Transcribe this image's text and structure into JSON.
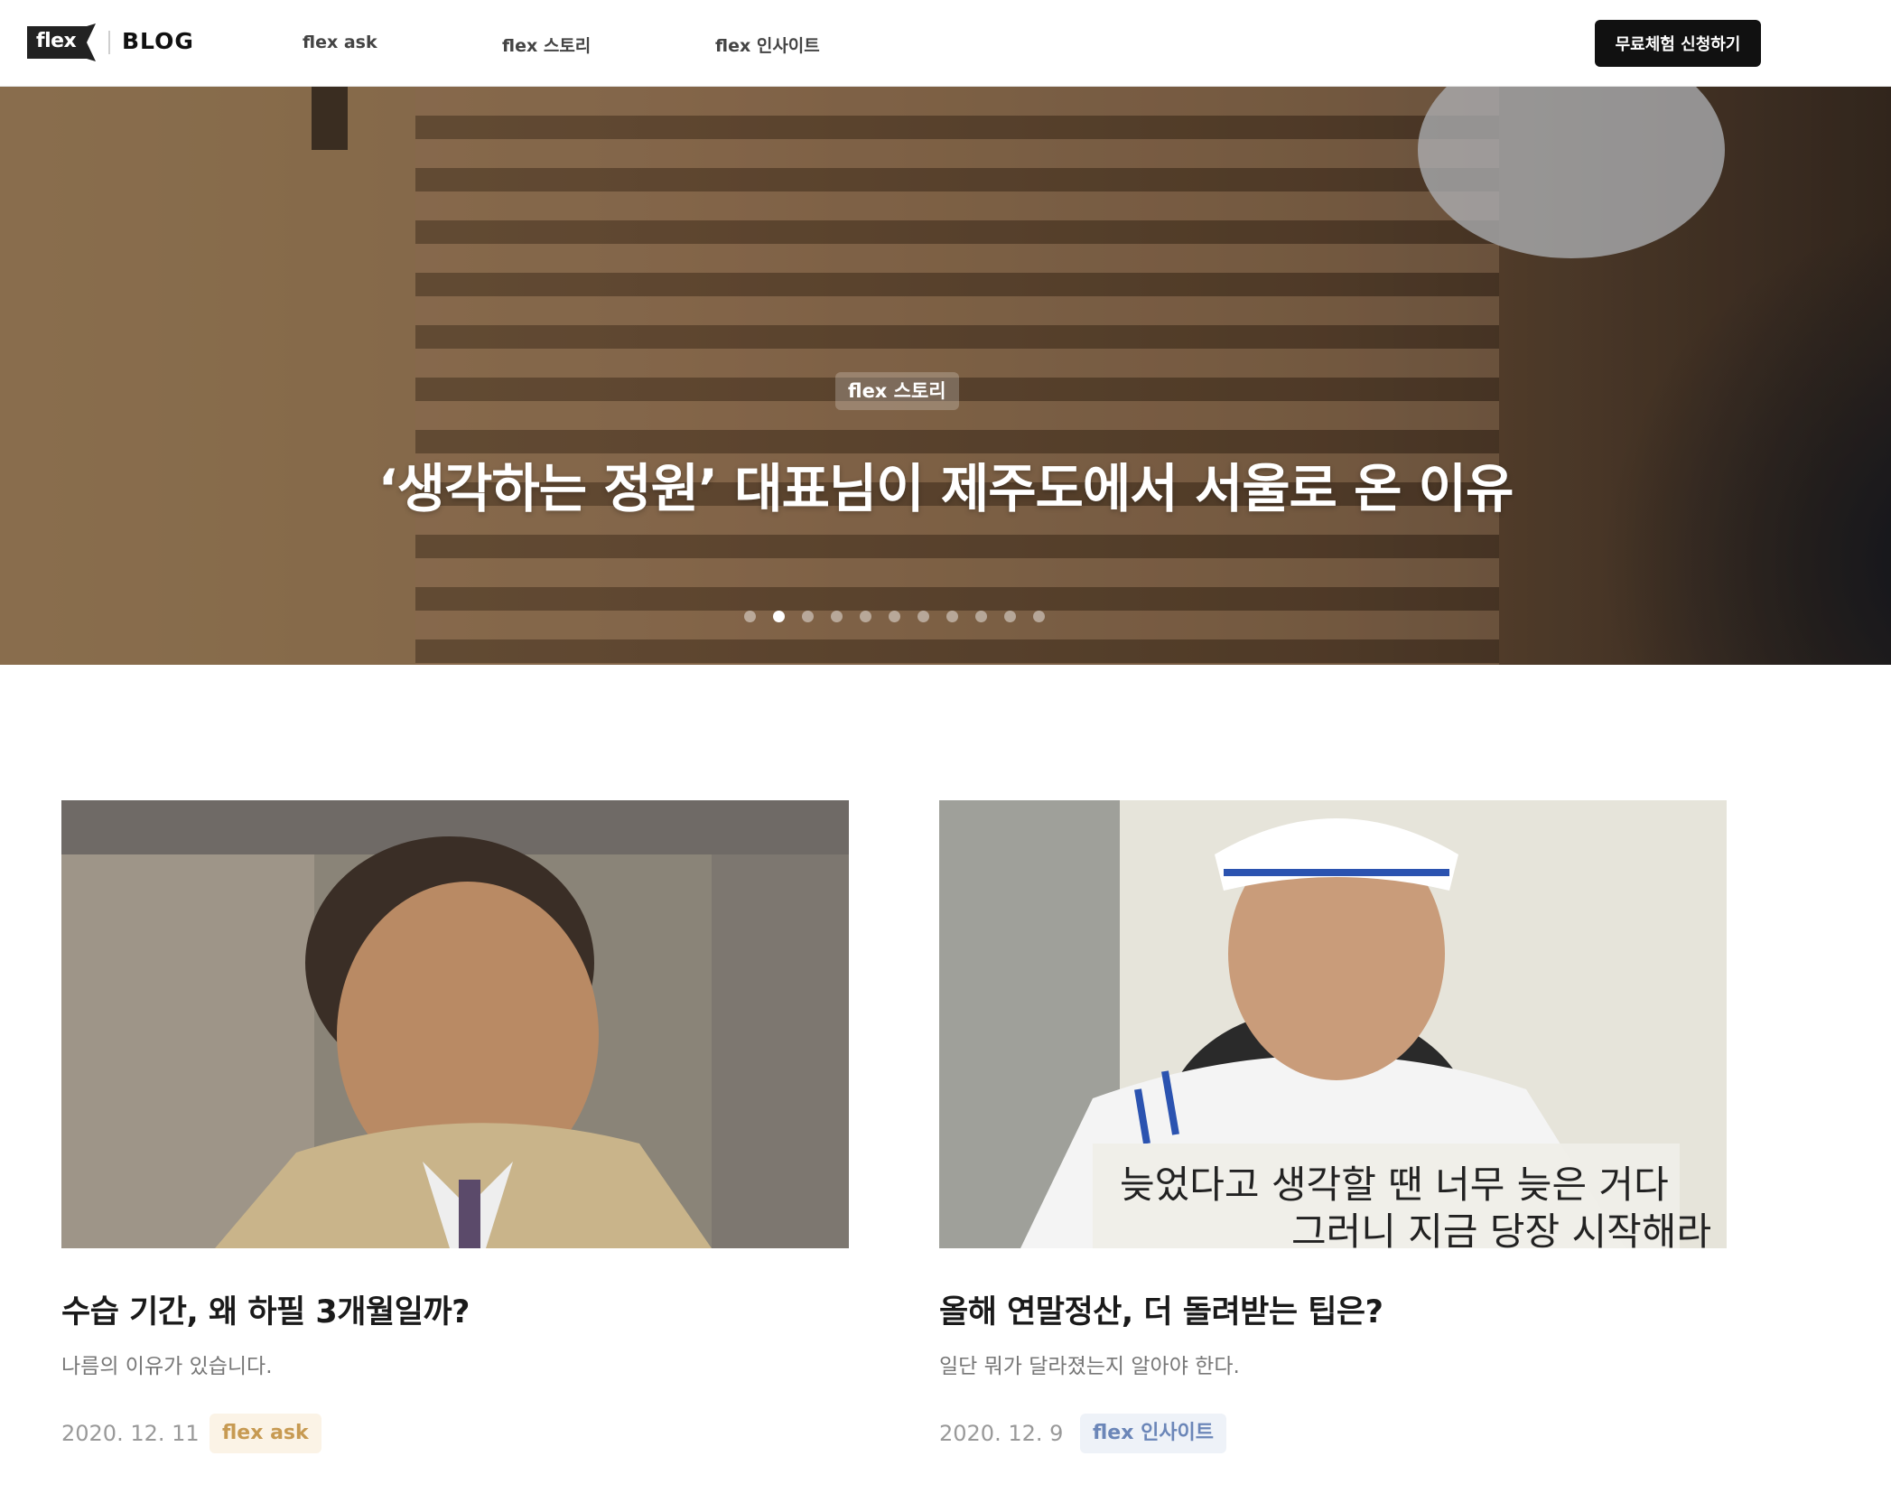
{
  "header": {
    "logo_text": "flex",
    "brand": "BLOG",
    "nav": [
      "flex ask",
      "flex 스토리",
      "flex 인사이트"
    ],
    "cta_label": "무료체험 신청하기"
  },
  "hero": {
    "badge": "flex 스토리",
    "title": "‘생각하는 정원’ 대표님이 제주도에서 서울로 온 이유",
    "dot_count": 11,
    "active_dot": 1
  },
  "posts": [
    {
      "title": "수습 기간, 왜 하필 3개월일까?",
      "subtitle": "나름의 이유가 있습니다.",
      "date": "2020. 12. 11",
      "tag": "flex ask"
    },
    {
      "title": "올해 연말정산, 더 돌려받는 팁은?",
      "subtitle": "일단 뭐가 달라졌는지 알아야 한다.",
      "date": "2020. 12. 9",
      "tag": "flex 인사이트",
      "image_caption": [
        "늦었다고 생각할 땐 너무 늦은 거다",
        "그러니 지금 당장 시작해라"
      ]
    }
  ],
  "colors": {
    "cta_bg": "#111111",
    "tag_ask_bg": "#fbf3e6",
    "tag_ask_text": "#c79a52",
    "tag_insight_bg": "#eef2f8",
    "tag_insight_text": "#6b86b8"
  }
}
